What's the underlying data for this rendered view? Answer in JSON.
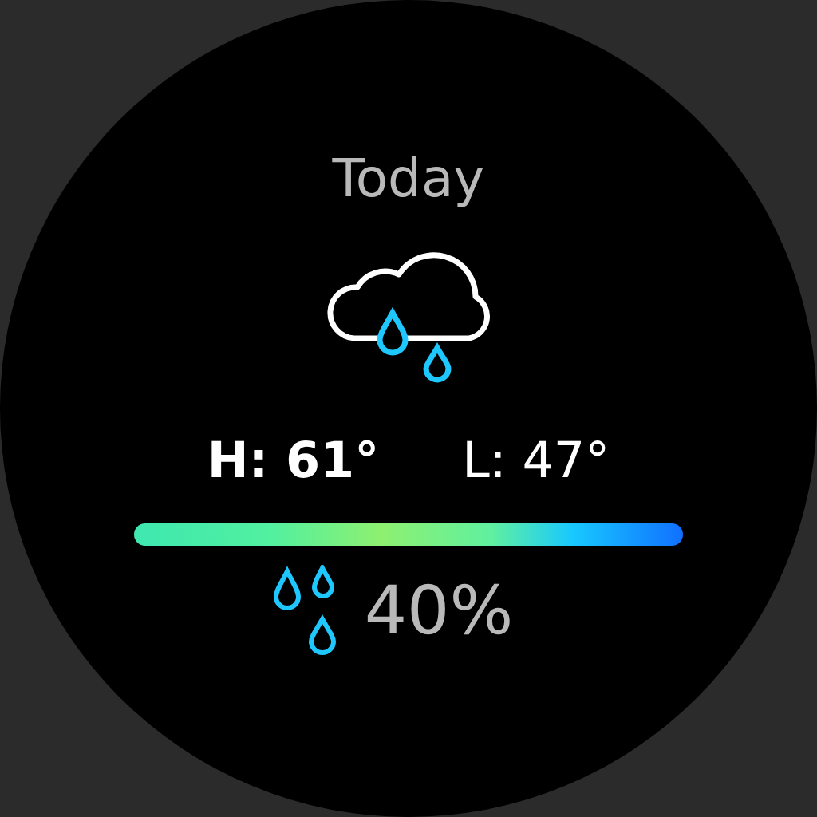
{
  "title": "Today",
  "forecast": {
    "high": "H: 61°",
    "low": "L: 47°"
  },
  "precipitation": {
    "chance": "40%"
  }
}
